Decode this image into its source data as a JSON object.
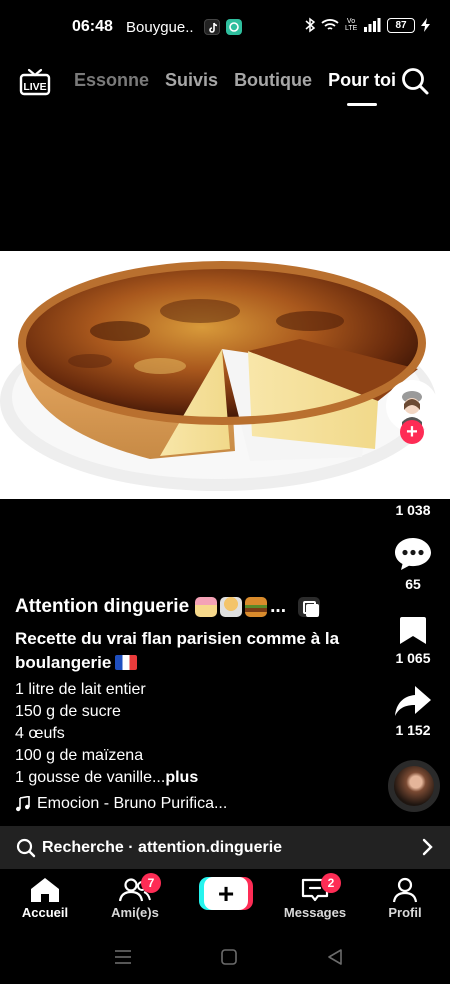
{
  "status_bar": {
    "time": "06:48",
    "carrier": "Bouygue..",
    "battery": "87",
    "network_label": "Vo LTE"
  },
  "top_nav": {
    "live_label": "LIVE",
    "tabs": [
      "Essonne",
      "Suivis",
      "Boutique",
      "Pour toi"
    ],
    "active_tab": "Pour toi"
  },
  "actions": {
    "likes": "1 038",
    "comments": "65",
    "saves": "1 065",
    "shares": "1 152"
  },
  "caption": {
    "creator": "Attention dinguerie",
    "title": "Recette du vrai flan parisien comme à la boulangerie",
    "lines": [
      "1 litre de lait entier",
      "150 g de sucre",
      "4 œufs",
      "100 g de maïzena",
      "1 gousse de vanille..."
    ],
    "more": "plus",
    "sound": "Emocion - Bruno Purifica..."
  },
  "search_bar": {
    "label": "Recherche · attention.dinguerie"
  },
  "bottom_nav": {
    "home": "Accueil",
    "friends": "Ami(e)s",
    "friends_badge": "7",
    "messages": "Messages",
    "messages_badge": "2",
    "profile": "Profil"
  },
  "colors": {
    "accent": "#fe2c55",
    "cyan": "#25f4ee",
    "background": "#000000",
    "search_bar": "#222222"
  }
}
